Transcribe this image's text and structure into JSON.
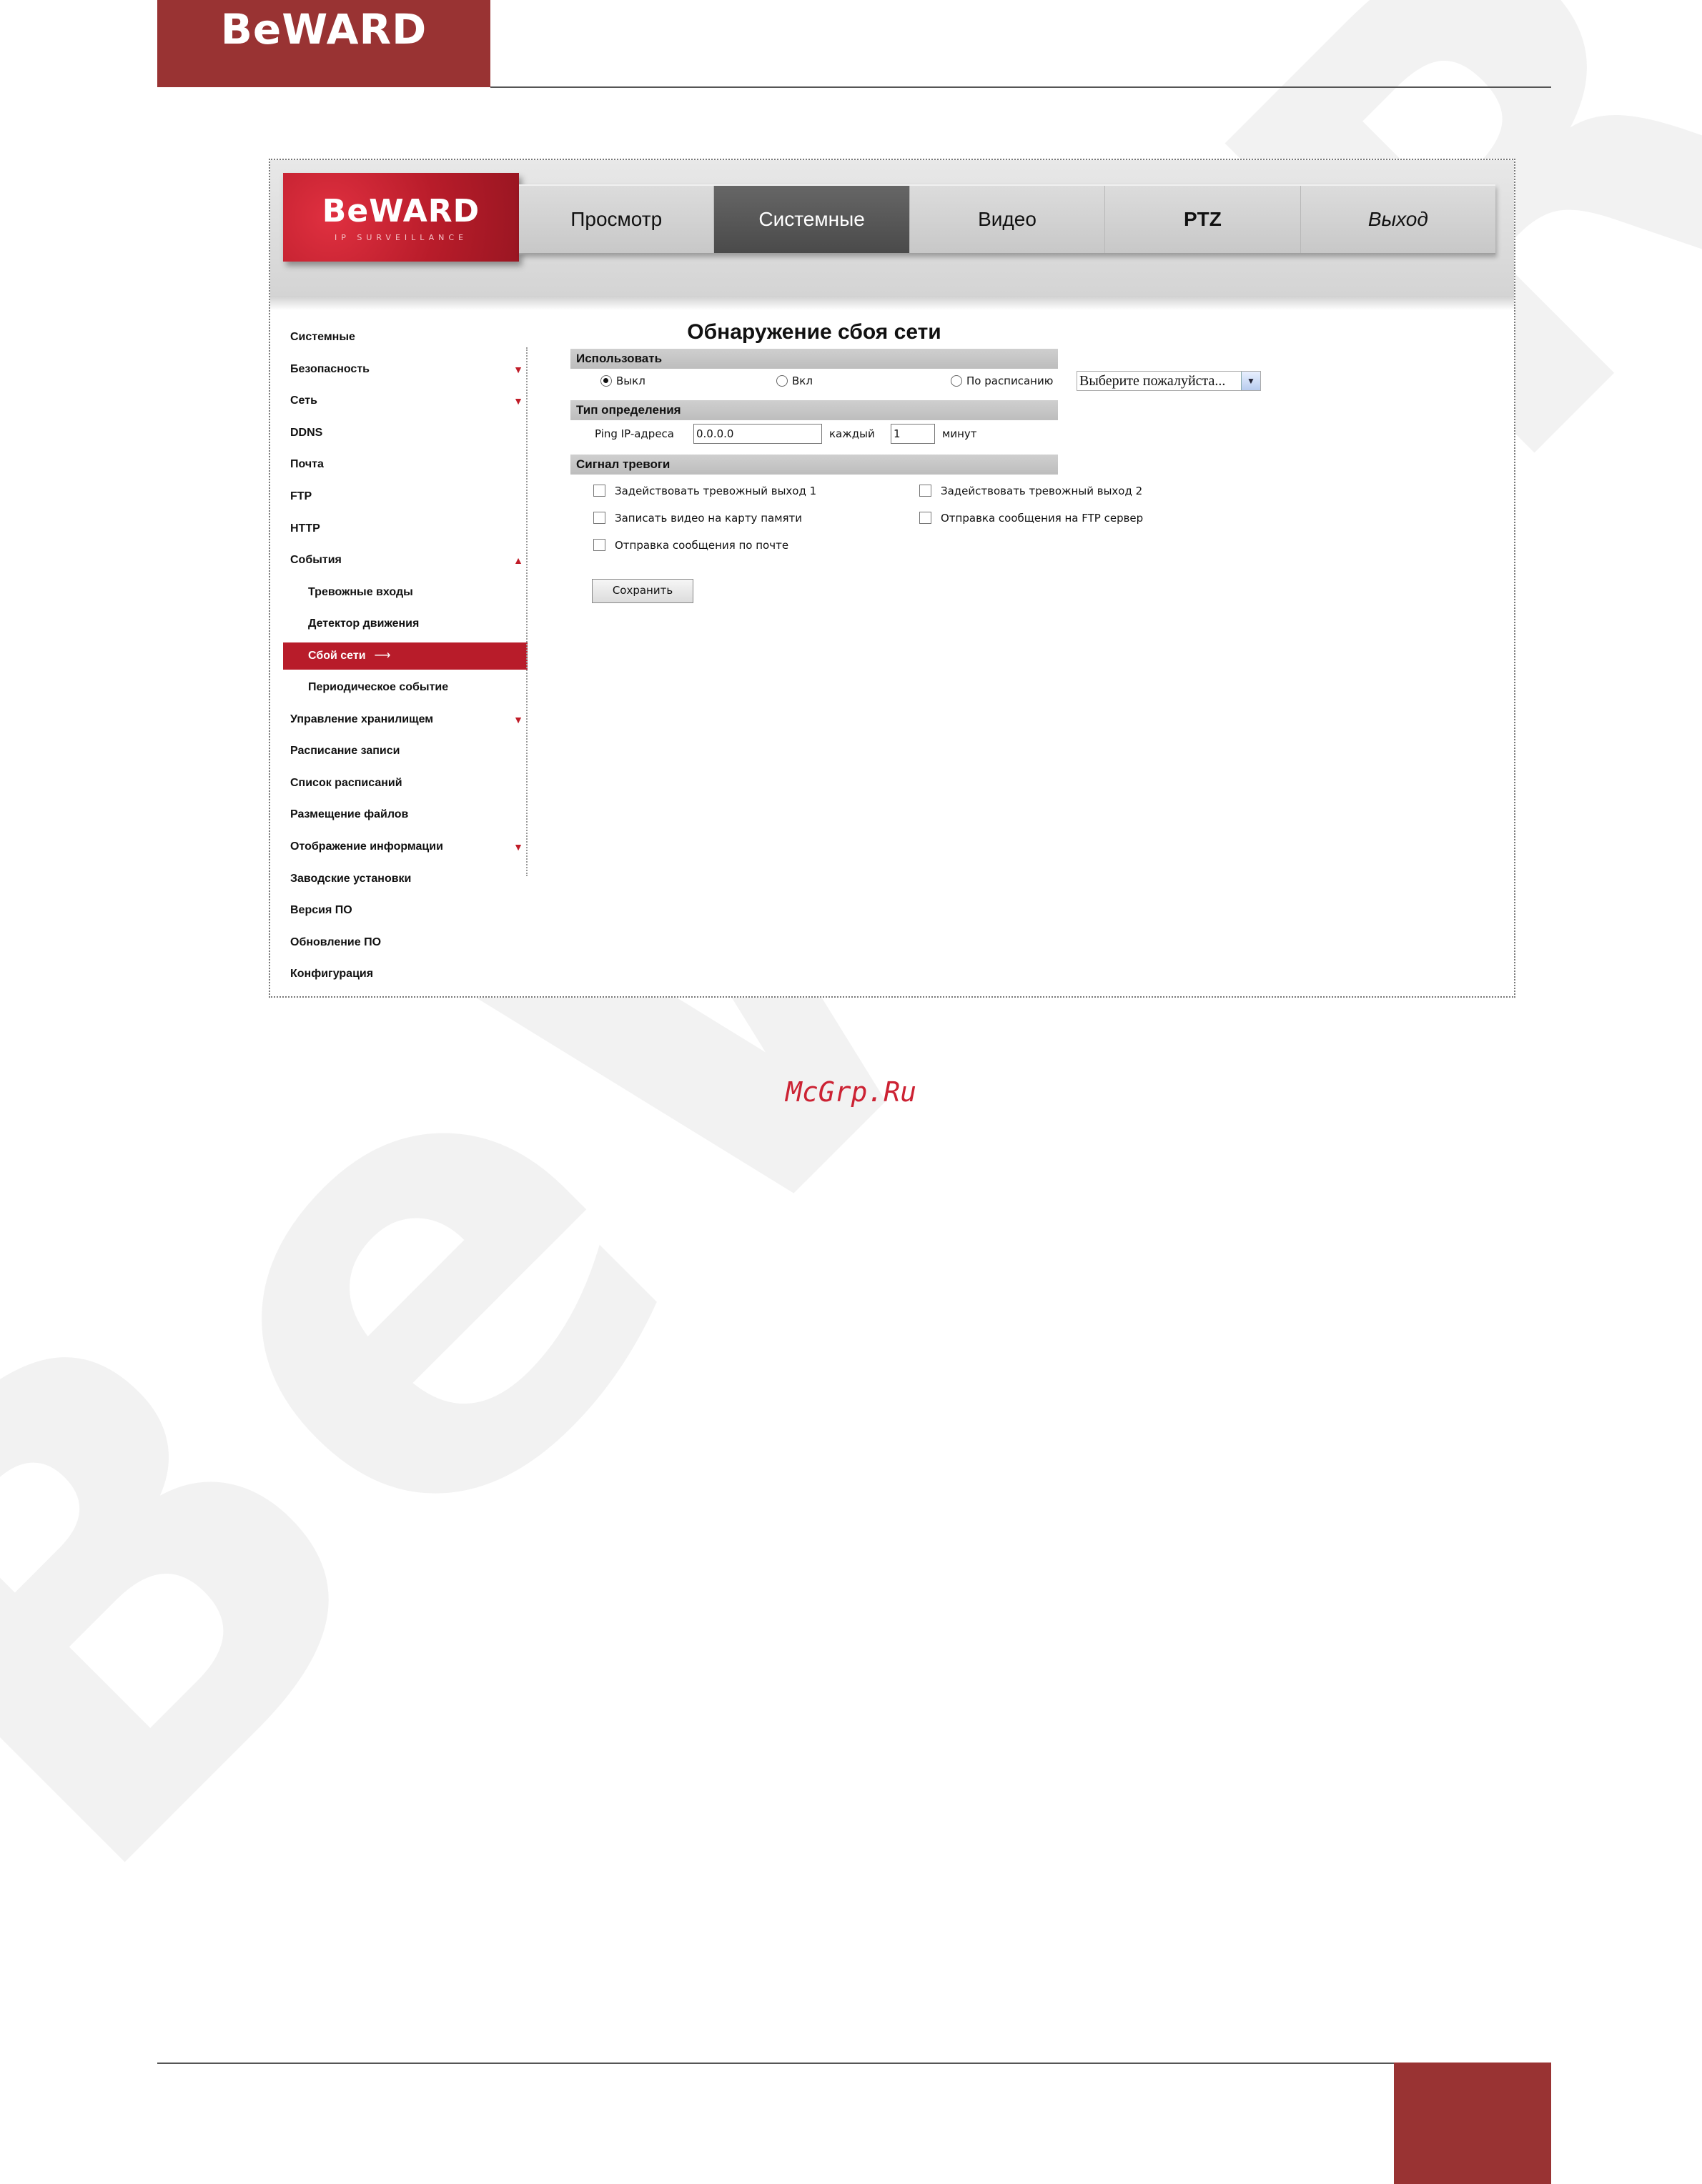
{
  "page": {
    "header_logo": "BeWARD",
    "site_credit": "McGrp.Ru",
    "watermark": "BeWARD"
  },
  "app": {
    "logo": {
      "word": "BeWARD",
      "subtitle": "IP SURVEILLANCE"
    },
    "nav": [
      {
        "label": "Просмотр"
      },
      {
        "label": "Системные"
      },
      {
        "label": "Видео"
      },
      {
        "label": "PTZ"
      },
      {
        "label": "Выход"
      }
    ],
    "sidebar": [
      {
        "label": "Системные"
      },
      {
        "label": "Безопасность"
      },
      {
        "label": "Сеть"
      },
      {
        "label": "DDNS"
      },
      {
        "label": "Почта"
      },
      {
        "label": "FTP"
      },
      {
        "label": "HTTP"
      },
      {
        "label": "События"
      },
      {
        "label": "Тревожные входы"
      },
      {
        "label": "Детектор движения"
      },
      {
        "label": "Сбой сети"
      },
      {
        "label": "Периодическое событие"
      },
      {
        "label": "Управление хранилищем"
      },
      {
        "label": "Расписание записи"
      },
      {
        "label": "Список расписаний"
      },
      {
        "label": "Размещение файлов"
      },
      {
        "label": "Отображение информации"
      },
      {
        "label": "Заводские установки"
      },
      {
        "label": "Версия ПО"
      },
      {
        "label": "Обновление ПО"
      },
      {
        "label": "Конфигурация"
      }
    ],
    "content": {
      "title": "Обнаружение сбоя сети",
      "use": {
        "heading": "Использовать",
        "off": "Выкл",
        "on": "Вкл",
        "schedule": "По расписанию",
        "schedule_select": "Выберите пожалуйста..."
      },
      "detection": {
        "heading": "Тип определения",
        "ping_label": "Ping IP-адреса",
        "ping_value": "0.0.0.0",
        "every_label": "каждый",
        "every_value": "1",
        "minutes_label": "минут"
      },
      "alarm": {
        "heading": "Сигнал тревоги",
        "output1": "Задействовать тревожный выход 1",
        "output2": "Задействовать тревожный выход 2",
        "record_sd": "Записать видео на карту памяти",
        "ftp": "Отправка сообщения на FTP сервер",
        "email": "Отправка сообщения по почте"
      },
      "save": "Сохранить"
    }
  }
}
